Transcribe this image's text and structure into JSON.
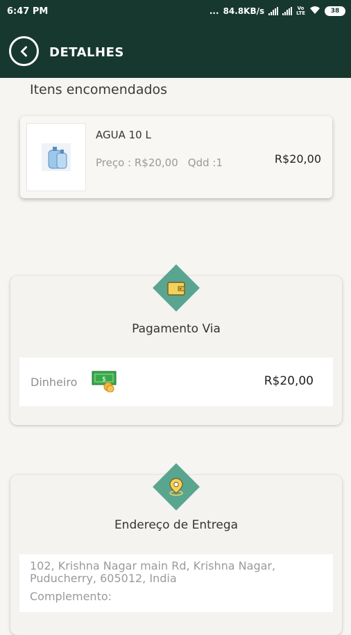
{
  "status_bar": {
    "time": "6:47 PM",
    "dots": "...",
    "network_speed": "84.8KB/s",
    "volte_top": "Vo",
    "volte_bottom": "LTE",
    "battery": "38"
  },
  "header": {
    "title": "DETALHES",
    "back_icon": "chevron-left-circle-icon"
  },
  "ordered_items": {
    "title": "Itens encomendados",
    "items": [
      {
        "name": "AGUA 10 L",
        "price_label": "Preço : R$20,00",
        "qty_label": "Qdd :1",
        "total": "R$20,00",
        "image_icon": "water-bottle-icon"
      }
    ]
  },
  "payment": {
    "icon": "wallet-icon",
    "title": "Pagamento Via",
    "method": "Dinheiro",
    "method_icon": "cash-icon",
    "amount": "R$20,00"
  },
  "delivery": {
    "icon": "location-pin-icon",
    "title": "Endereço de Entrega",
    "address": "102, Krishna Nagar main Rd, Krishna Nagar, Puducherry, 605012, India",
    "complement_label": "Complemento:"
  },
  "colors": {
    "header_bg": "#17382e",
    "accent": "#5aa58f",
    "background": "#f6f5f2"
  }
}
